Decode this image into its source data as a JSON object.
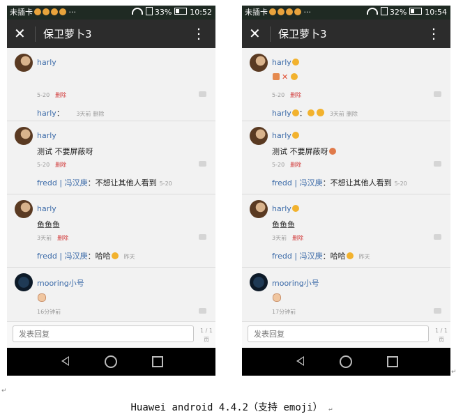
{
  "screens": [
    {
      "status": {
        "carrier": "未插卡",
        "battery": "33%",
        "time": "10:52"
      },
      "toolbar": {
        "title": "保卫萝卜3",
        "close": "✕",
        "menu": "⋮"
      },
      "posts": [
        {
          "user": "harly",
          "text": "",
          "time": "5-20",
          "delete": "删除",
          "reply": {
            "prefix": "harly",
            "text": "：",
            "time": "3天前",
            "delete": "删除"
          }
        },
        {
          "user": "harly",
          "text": "测试 不要屏蔽呀",
          "time": "5-20",
          "delete": "删除",
          "reply": {
            "prefix": "fredd | 冯汉庚",
            "text": "：不想让其他人看到",
            "time": "5-20"
          }
        },
        {
          "user": "harly",
          "text": "鱼鱼鱼",
          "time": "3天前",
          "delete": "删除",
          "reply": {
            "prefix": "fredd | 冯汉庚",
            "text": "：哈哈",
            "time": "昨天"
          }
        },
        {
          "user": "mooring小号",
          "text": "",
          "time": "16分钟前"
        }
      ],
      "input": {
        "placeholder": "发表回复"
      },
      "pager": {
        "pages": "1 / 1",
        "unit": "页"
      }
    },
    {
      "status": {
        "carrier": "未插卡",
        "battery": "32%",
        "time": "10:54"
      },
      "toolbar": {
        "title": "保卫萝卜3",
        "close": "✕",
        "menu": "⋮"
      },
      "posts": [
        {
          "user": "harly",
          "text": "",
          "time": "5-20",
          "delete": "删除",
          "reply": {
            "prefix": "harly",
            "text": "：",
            "time": "3天前",
            "delete": "删除"
          }
        },
        {
          "user": "harly",
          "text": "测试 不要屏蔽呀",
          "time": "5-20",
          "delete": "删除",
          "reply": {
            "prefix": "fredd | 冯汉庚",
            "text": "：不想让其他人看到",
            "time": "5-20"
          }
        },
        {
          "user": "harly",
          "text": "鱼鱼鱼",
          "time": "3天前",
          "delete": "删除",
          "reply": {
            "prefix": "fredd | 冯汉庚",
            "text": "：哈哈",
            "time": "昨天"
          }
        },
        {
          "user": "mooring小号",
          "text": "",
          "time": "17分钟前"
        }
      ],
      "input": {
        "placeholder": "发表回复"
      },
      "pager": {
        "pages": "1 / 1",
        "unit": "页"
      }
    }
  ],
  "caption": "Huawei android 4.4.2（支持 emoji）",
  "colors": {
    "toolbar": "#2c2c2c",
    "statusbar": "#1f2a23",
    "username": "#3b6aa8",
    "delete": "#d23a3a"
  },
  "icons": [
    "close-icon",
    "more-vert-icon",
    "wifi-icon",
    "battery-icon",
    "back-icon",
    "home-icon",
    "recent-apps-icon",
    "comment-icon"
  ]
}
